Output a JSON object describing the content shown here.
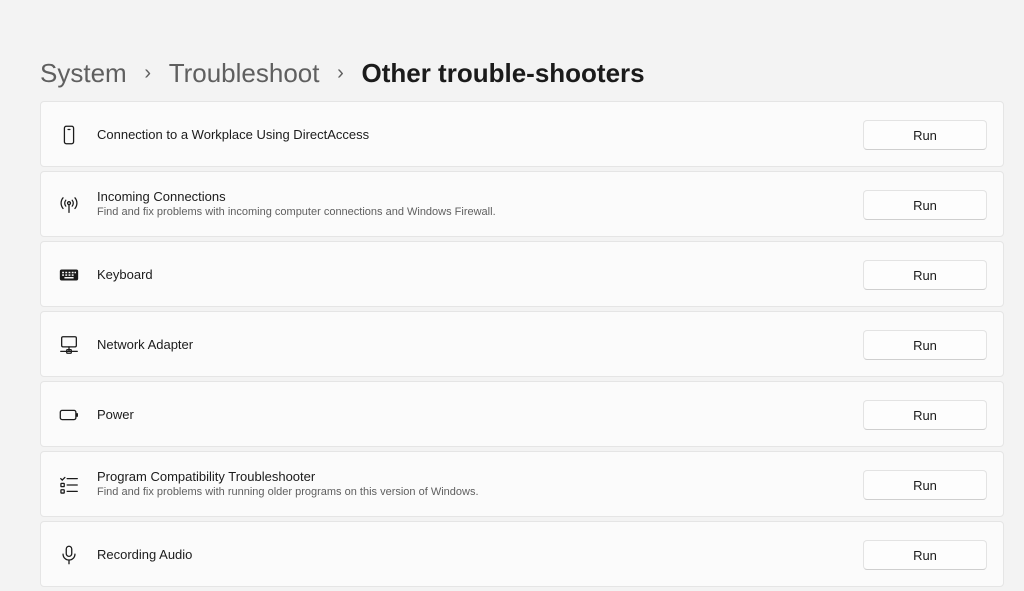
{
  "breadcrumb": {
    "items": [
      "System",
      "Troubleshoot",
      "Other trouble-shooters"
    ],
    "separator": "›"
  },
  "troubleshooters": [
    {
      "icon": "phone-icon",
      "title": "Connection to a Workplace Using DirectAccess",
      "description": "",
      "button": "Run"
    },
    {
      "icon": "antenna-icon",
      "title": "Incoming Connections",
      "description": "Find and fix problems with incoming computer connections and Windows Firewall.",
      "button": "Run"
    },
    {
      "icon": "keyboard-icon",
      "title": "Keyboard",
      "description": "",
      "button": "Run"
    },
    {
      "icon": "network-adapter-icon",
      "title": "Network Adapter",
      "description": "",
      "button": "Run"
    },
    {
      "icon": "battery-icon",
      "title": "Power",
      "description": "",
      "button": "Run"
    },
    {
      "icon": "checklist-icon",
      "title": "Program Compatibility Troubleshooter",
      "description": "Find and fix problems with running older programs on this version of Windows.",
      "button": "Run"
    },
    {
      "icon": "microphone-icon",
      "title": "Recording Audio",
      "description": "",
      "button": "Run"
    }
  ]
}
